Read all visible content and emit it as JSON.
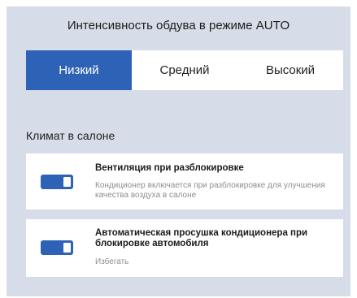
{
  "auto_mode": {
    "title": "Интенсивность обдува в режиме AUTO",
    "options": [
      "Низкий",
      "Средний",
      "Высокий"
    ],
    "selected": "Низкий"
  },
  "climate": {
    "section_title": "Климат в салоне",
    "items": [
      {
        "title": "Вентиляция при разблокировке",
        "subtitle": "Кондиционер включается при разблокировке для улучшения качества воздуха в салоне",
        "enabled": true
      },
      {
        "title": "Автоматическая просушка кондиционера при блокировке автомобиля",
        "subtitle": "Избегать",
        "enabled": true
      }
    ]
  },
  "colors": {
    "accent": "#2e62b6",
    "panel_background": "#d6dde8",
    "card_background": "#ffffff"
  }
}
